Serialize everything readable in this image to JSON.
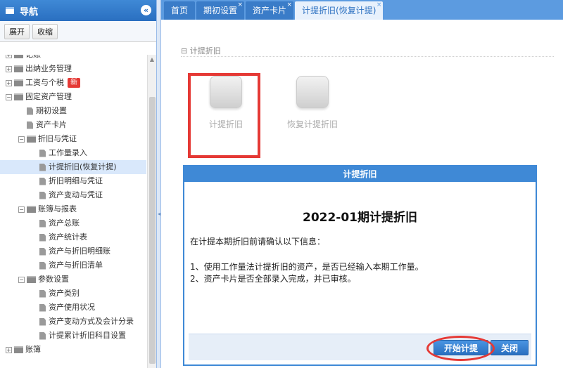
{
  "sidebar": {
    "title": "导航",
    "collapse_icon": "«",
    "toolbar": {
      "expand_label": "展开",
      "collapse_label": "收缩"
    },
    "tree": [
      {
        "label": "记账",
        "level": 0,
        "type": "folder",
        "toggle": "+"
      },
      {
        "label": "出纳业务管理",
        "level": 0,
        "type": "folder",
        "toggle": "+"
      },
      {
        "label": "工资与个税",
        "level": 0,
        "type": "folder",
        "toggle": "+",
        "badge": "新"
      },
      {
        "label": "固定资产管理",
        "level": 0,
        "type": "folder",
        "toggle": "−"
      },
      {
        "label": "期初设置",
        "level": 1,
        "type": "doc"
      },
      {
        "label": "资产卡片",
        "level": 1,
        "type": "doc"
      },
      {
        "label": "折旧与凭证",
        "level": 1,
        "type": "folder",
        "toggle": "−"
      },
      {
        "label": "工作量录入",
        "level": 2,
        "type": "doc"
      },
      {
        "label": "计提折旧(恢复计提)",
        "level": 2,
        "type": "doc",
        "selected": true
      },
      {
        "label": "折旧明细与凭证",
        "level": 2,
        "type": "doc"
      },
      {
        "label": "资产变动与凭证",
        "level": 2,
        "type": "doc"
      },
      {
        "label": "账簿与报表",
        "level": 1,
        "type": "folder",
        "toggle": "−"
      },
      {
        "label": "资产总账",
        "level": 2,
        "type": "doc"
      },
      {
        "label": "资产统计表",
        "level": 2,
        "type": "doc"
      },
      {
        "label": "资产与折旧明细账",
        "level": 2,
        "type": "doc"
      },
      {
        "label": "资产与折旧清单",
        "level": 2,
        "type": "doc"
      },
      {
        "label": "参数设置",
        "level": 1,
        "type": "folder",
        "toggle": "−"
      },
      {
        "label": "资产类别",
        "level": 2,
        "type": "doc"
      },
      {
        "label": "资产使用状况",
        "level": 2,
        "type": "doc"
      },
      {
        "label": "资产变动方式及会计分录",
        "level": 2,
        "type": "doc"
      },
      {
        "label": "计提累计折旧科目设置",
        "level": 2,
        "type": "doc"
      },
      {
        "label": "账簿",
        "level": 0,
        "type": "folder",
        "toggle": "+"
      }
    ]
  },
  "tabs": [
    {
      "label": "首页",
      "closable": false,
      "active": false
    },
    {
      "label": "期初设置",
      "closable": true,
      "active": false
    },
    {
      "label": "资产卡片",
      "closable": true,
      "active": false
    },
    {
      "label": "计提折旧(恢复计提)",
      "closable": true,
      "active": true
    }
  ],
  "main": {
    "section_title": "计提折旧",
    "tiles": {
      "accrue_label": "计提折旧",
      "restore_label": "恢复计提折旧"
    }
  },
  "dialog": {
    "header": "计提折旧",
    "title": "2022-01期计提折旧",
    "intro": "在计提本期折旧前请确认以下信息：",
    "item1": "1、使用工作量法计提折旧的资产，是否已经输入本期工作量。",
    "item2": "2、资产卡片是否全部录入完成，并已审核。",
    "start_button": "开始计提",
    "close_button": "关闭"
  },
  "colors": {
    "accent": "#3f89d6",
    "highlight": "#e53935"
  }
}
